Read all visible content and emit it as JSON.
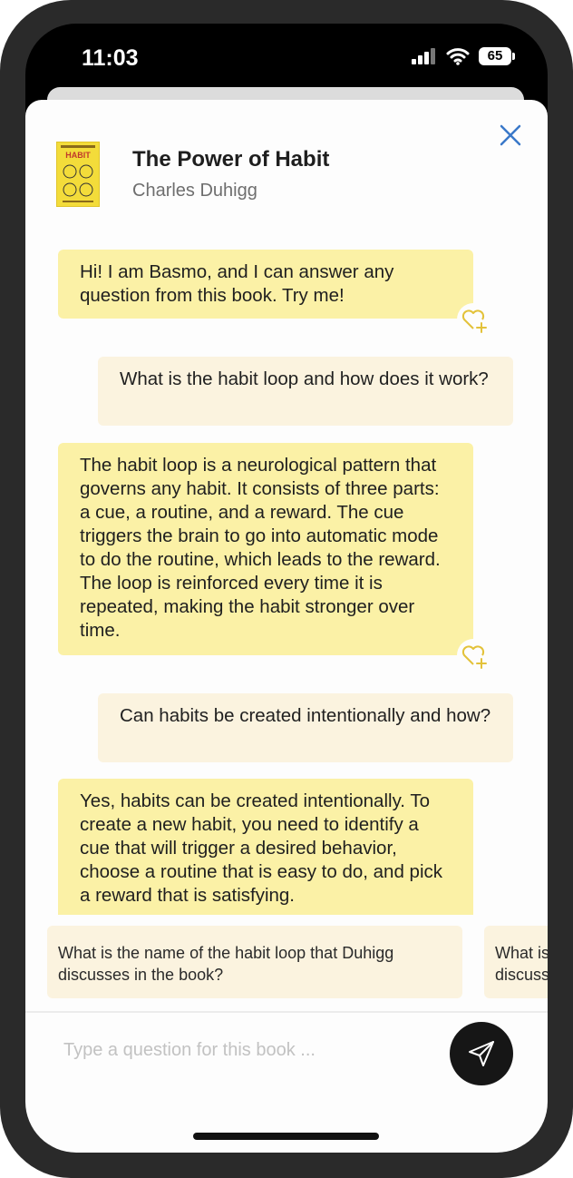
{
  "status_bar": {
    "time": "11:03",
    "battery": "65"
  },
  "book": {
    "title": "The Power of Habit",
    "author": "Charles Duhigg",
    "cover_text": "HABIT"
  },
  "messages": [
    {
      "role": "bot",
      "text": "Hi! I am Basmo, and I can answer any question from this book. Try me!"
    },
    {
      "role": "user",
      "text": "What is the habit loop and how does it work?"
    },
    {
      "role": "bot",
      "text": "The habit loop is a neurological pattern that governs any habit. It consists of three parts: a cue, a routine, and a reward. The cue triggers the brain to go into automatic mode to do the routine, which leads to the reward. The loop is reinforced every time it is repeated, making the habit stronger over time."
    },
    {
      "role": "user",
      "text": "Can habits be created intentionally and how?"
    },
    {
      "role": "bot",
      "text": "Yes, habits can be created intentionally. To create a new habit, you need to identify a cue that will trigger a desired behavior, choose a routine that is easy to do, and pick a reward that is satisfying."
    }
  ],
  "suggestions": [
    "What is the name of the habit loop that Duhigg discusses in the book?",
    "What is the name of the habit loop that Duhigg discusses in the book?"
  ],
  "composer": {
    "placeholder": "Type a question for this book ..."
  },
  "icons": {
    "close": "close-icon",
    "favorite": "heart-plus-icon",
    "send": "send-icon"
  },
  "colors": {
    "bot_bubble": "#fbf1a6",
    "user_bubble": "#fbf3df",
    "accent": "#3a78c9"
  }
}
